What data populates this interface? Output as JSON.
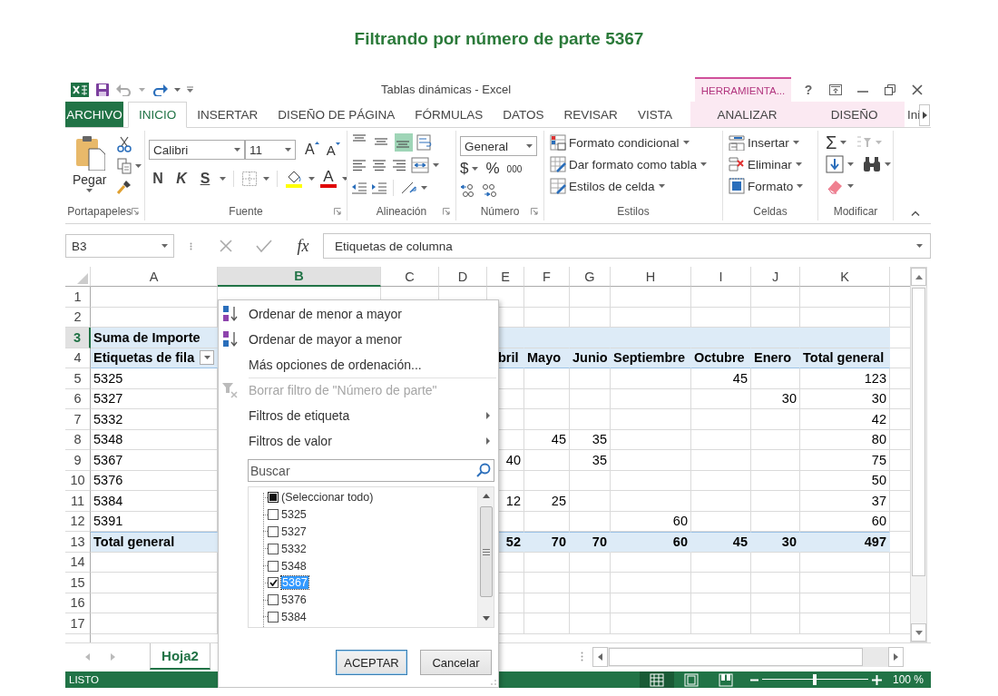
{
  "heading": "Filtrando por número de parte 5367",
  "window": {
    "title": "Tablas dinámicas - Excel",
    "context_label": "HERRAMIENTA...",
    "help": "?"
  },
  "tabs": [
    {
      "label": "ARCHIVO",
      "kind": "file",
      "selected": false
    },
    {
      "label": "INICIO",
      "kind": "normal",
      "selected": true
    },
    {
      "label": "INSERTAR",
      "kind": "normal",
      "selected": false
    },
    {
      "label": "DISEÑO DE PÁGINA",
      "kind": "normal",
      "selected": false
    },
    {
      "label": "FÓRMULAS",
      "kind": "normal",
      "selected": false
    },
    {
      "label": "DATOS",
      "kind": "normal",
      "selected": false
    },
    {
      "label": "REVISAR",
      "kind": "normal",
      "selected": false
    },
    {
      "label": "VISTA",
      "kind": "normal",
      "selected": false
    },
    {
      "label": "ANALIZAR",
      "kind": "context",
      "selected": false
    },
    {
      "label": "DISEÑO",
      "kind": "context",
      "selected": false
    },
    {
      "label": "Ini",
      "kind": "cut",
      "selected": false
    }
  ],
  "ribbon": {
    "clipboard": {
      "label": "Portapapeles",
      "paste": "Pegar"
    },
    "font": {
      "label": "Fuente",
      "name": "Calibri",
      "size": "11",
      "grow": "A",
      "shrink": "A",
      "bold": "N",
      "italic": "K",
      "underline": "S",
      "color_letter": "A"
    },
    "alignment": {
      "label": "Alineación",
      "vertical": [
        {
          "selected": false
        },
        {
          "selected": false
        },
        {
          "selected": true
        }
      ]
    },
    "number": {
      "label": "Número",
      "format": "General",
      "currency": "$",
      "percent": "%",
      "thousands": "000"
    },
    "styles": {
      "label": "Estilos",
      "items": [
        "Formato condicional",
        "Dar formato como tabla",
        "Estilos de celda"
      ]
    },
    "cells": {
      "label": "Celdas",
      "items": [
        "Insertar",
        "Eliminar",
        "Formato"
      ]
    },
    "editing": {
      "label": "Modificar",
      "sum": "Σ"
    }
  },
  "formula_bar": {
    "name_box": "B3",
    "fx": "fx",
    "value": "Etiquetas de columna"
  },
  "grid": {
    "columns": [
      {
        "letter": "A",
        "selected": false
      },
      {
        "letter": "B",
        "selected": true
      },
      {
        "letter": "C",
        "selected": false
      },
      {
        "letter": "D",
        "selected": false
      },
      {
        "letter": "E",
        "selected": false
      },
      {
        "letter": "F",
        "selected": false
      },
      {
        "letter": "G",
        "selected": false
      },
      {
        "letter": "H",
        "selected": false
      },
      {
        "letter": "I",
        "selected": false
      },
      {
        "letter": "J",
        "selected": false
      },
      {
        "letter": "K",
        "selected": false
      }
    ],
    "rows": [
      {
        "number": "1",
        "kind": "blank",
        "selected": false,
        "cells": {}
      },
      {
        "number": "2",
        "kind": "blank",
        "selected": false,
        "cells": {}
      },
      {
        "number": "3",
        "kind": "header",
        "selected": true,
        "cells": {
          "A": "Suma de Importe"
        }
      },
      {
        "number": "4",
        "kind": "header",
        "selected": false,
        "filter": true,
        "cells": {
          "A": "Etiquetas de fila",
          "E": "bril",
          "F": "Mayo",
          "G": "Junio",
          "H": "Septiembre",
          "I": "Octubre",
          "J": "Enero",
          "K": "Total general"
        }
      },
      {
        "number": "5",
        "kind": "data",
        "selected": false,
        "cells": {
          "A": "5325",
          "I": "45",
          "K": "123"
        }
      },
      {
        "number": "6",
        "kind": "data",
        "selected": false,
        "cells": {
          "A": "5327",
          "J": "30",
          "K": "30"
        }
      },
      {
        "number": "7",
        "kind": "data",
        "selected": false,
        "cells": {
          "A": "5332",
          "K": "42"
        }
      },
      {
        "number": "8",
        "kind": "data",
        "selected": false,
        "cells": {
          "A": "5348",
          "F": "45",
          "G": "35",
          "K": "80"
        }
      },
      {
        "number": "9",
        "kind": "data",
        "selected": false,
        "cells": {
          "A": "5367",
          "E": "40",
          "G": "35",
          "K": "75"
        }
      },
      {
        "number": "10",
        "kind": "data",
        "selected": false,
        "cells": {
          "A": "5376",
          "K": "50"
        }
      },
      {
        "number": "11",
        "kind": "data",
        "selected": false,
        "cells": {
          "A": "5384",
          "E": "12",
          "F": "25",
          "K": "37"
        }
      },
      {
        "number": "12",
        "kind": "data",
        "selected": false,
        "cells": {
          "A": "5391",
          "H": "60",
          "K": "60"
        }
      },
      {
        "number": "13",
        "kind": "total",
        "selected": false,
        "cells": {
          "A": "Total general",
          "E": "52",
          "F": "70",
          "G": "70",
          "H": "60",
          "I": "45",
          "J": "30",
          "K": "497"
        }
      },
      {
        "number": "14",
        "kind": "blank",
        "selected": false,
        "cells": {}
      },
      {
        "number": "15",
        "kind": "blank",
        "selected": false,
        "cells": {}
      },
      {
        "number": "16",
        "kind": "blank",
        "selected": false,
        "cells": {}
      },
      {
        "number": "17",
        "kind": "blank",
        "selected": false,
        "cells": {}
      }
    ]
  },
  "filter_menu": {
    "items": [
      {
        "label": "Ordenar de menor a mayor",
        "kind": "sort-asc",
        "disabled": false,
        "submenu": false,
        "separator_above": false
      },
      {
        "label": "Ordenar de mayor a menor",
        "kind": "sort-desc",
        "disabled": false,
        "submenu": false,
        "separator_above": false
      },
      {
        "label": "Más opciones de ordenación...",
        "kind": "plain",
        "disabled": false,
        "submenu": false,
        "separator_above": false
      },
      {
        "label": "Borrar filtro de \"Número de parte\"",
        "kind": "clear-filter",
        "disabled": true,
        "submenu": false,
        "separator_above": true
      },
      {
        "label": "Filtros de etiqueta",
        "kind": "plain",
        "disabled": false,
        "submenu": true,
        "separator_above": false
      },
      {
        "label": "Filtros de valor",
        "kind": "plain",
        "disabled": false,
        "submenu": true,
        "separator_above": false
      }
    ],
    "search": {
      "placeholder": "Buscar"
    },
    "values": [
      {
        "label": "(Seleccionar todo)",
        "kind": "select-all",
        "checked": false,
        "selected": false
      },
      {
        "label": "5325",
        "kind": "value",
        "checked": false,
        "selected": false
      },
      {
        "label": "5327",
        "kind": "value",
        "checked": false,
        "selected": false
      },
      {
        "label": "5332",
        "kind": "value",
        "checked": false,
        "selected": false
      },
      {
        "label": "5348",
        "kind": "value",
        "checked": false,
        "selected": false
      },
      {
        "label": "5367",
        "kind": "value",
        "checked": true,
        "selected": true
      },
      {
        "label": "5376",
        "kind": "value",
        "checked": false,
        "selected": false
      },
      {
        "label": "5384",
        "kind": "value",
        "checked": false,
        "selected": false
      }
    ],
    "buttons": [
      {
        "label": "ACEPTAR",
        "default": true
      },
      {
        "label": "Cancelar",
        "default": false
      }
    ]
  },
  "sheets": [
    {
      "label": "Hoja2",
      "selected": true
    }
  ],
  "status": {
    "text": "LISTO",
    "views": [
      {
        "kind": "normal",
        "selected": true
      },
      {
        "kind": "page-layout",
        "selected": false
      },
      {
        "kind": "page-break",
        "selected": false
      }
    ],
    "zoom": {
      "level": 0.5,
      "label": "100 %"
    }
  }
}
